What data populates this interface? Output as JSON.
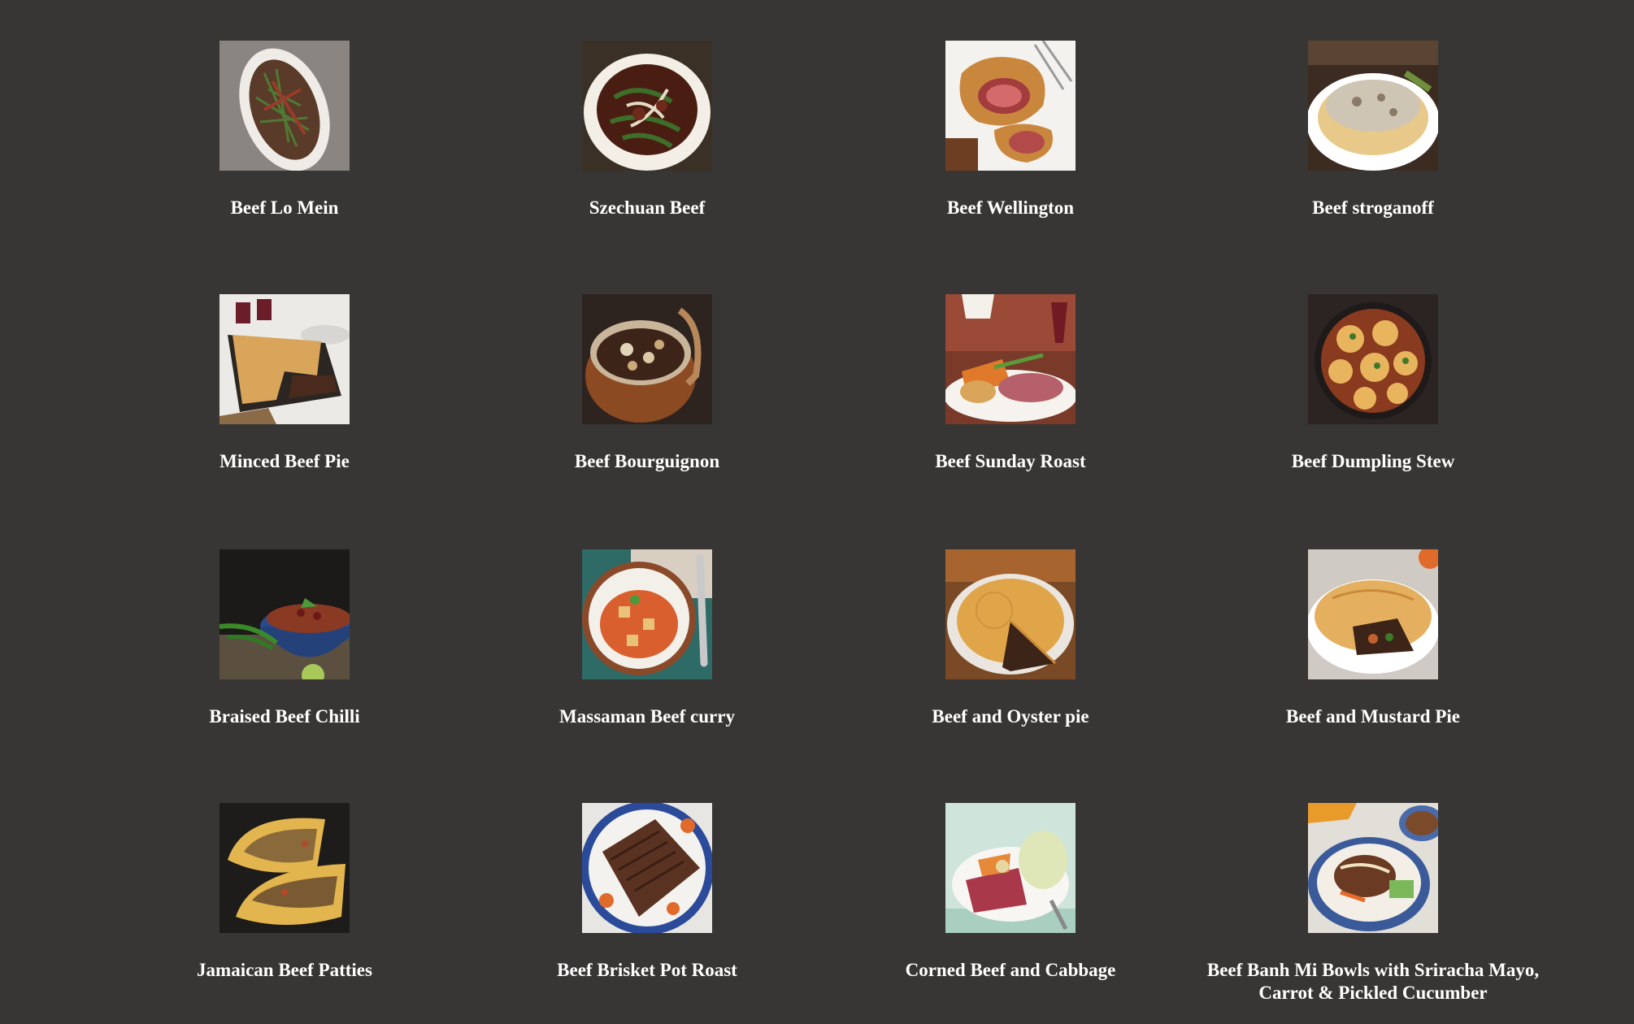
{
  "meals": [
    {
      "name": "Beef Lo Mein",
      "image": "beef-lo-mein-photo"
    },
    {
      "name": "Szechuan Beef",
      "image": "szechuan-beef-photo"
    },
    {
      "name": "Beef Wellington",
      "image": "beef-wellington-photo"
    },
    {
      "name": "Beef stroganoff",
      "image": "beef-stroganoff-photo"
    },
    {
      "name": "Minced Beef Pie",
      "image": "minced-beef-pie-photo"
    },
    {
      "name": "Beef Bourguignon",
      "image": "beef-bourguignon-photo"
    },
    {
      "name": "Beef Sunday Roast",
      "image": "beef-sunday-roast-photo"
    },
    {
      "name": "Beef Dumpling Stew",
      "image": "beef-dumpling-stew-photo"
    },
    {
      "name": "Braised Beef Chilli",
      "image": "braised-beef-chilli-photo"
    },
    {
      "name": "Massaman Beef curry",
      "image": "massaman-beef-curry-photo"
    },
    {
      "name": "Beef and Oyster pie",
      "image": "beef-and-oyster-pie-photo"
    },
    {
      "name": "Beef and Mustard Pie",
      "image": "beef-and-mustard-pie-photo"
    },
    {
      "name": "Jamaican Beef Patties",
      "image": "jamaican-beef-patties-photo"
    },
    {
      "name": "Beef Brisket Pot Roast",
      "image": "beef-brisket-pot-roast-photo"
    },
    {
      "name": "Corned Beef and Cabbage",
      "image": "corned-beef-and-cabbage-photo"
    },
    {
      "name": "Beef Banh Mi Bowls with Sriracha Mayo, Carrot & Pickled Cucumber",
      "image": "beef-banh-mi-bowls-photo"
    }
  ],
  "colors": {
    "background": "#383634",
    "text": "#ffffff"
  }
}
